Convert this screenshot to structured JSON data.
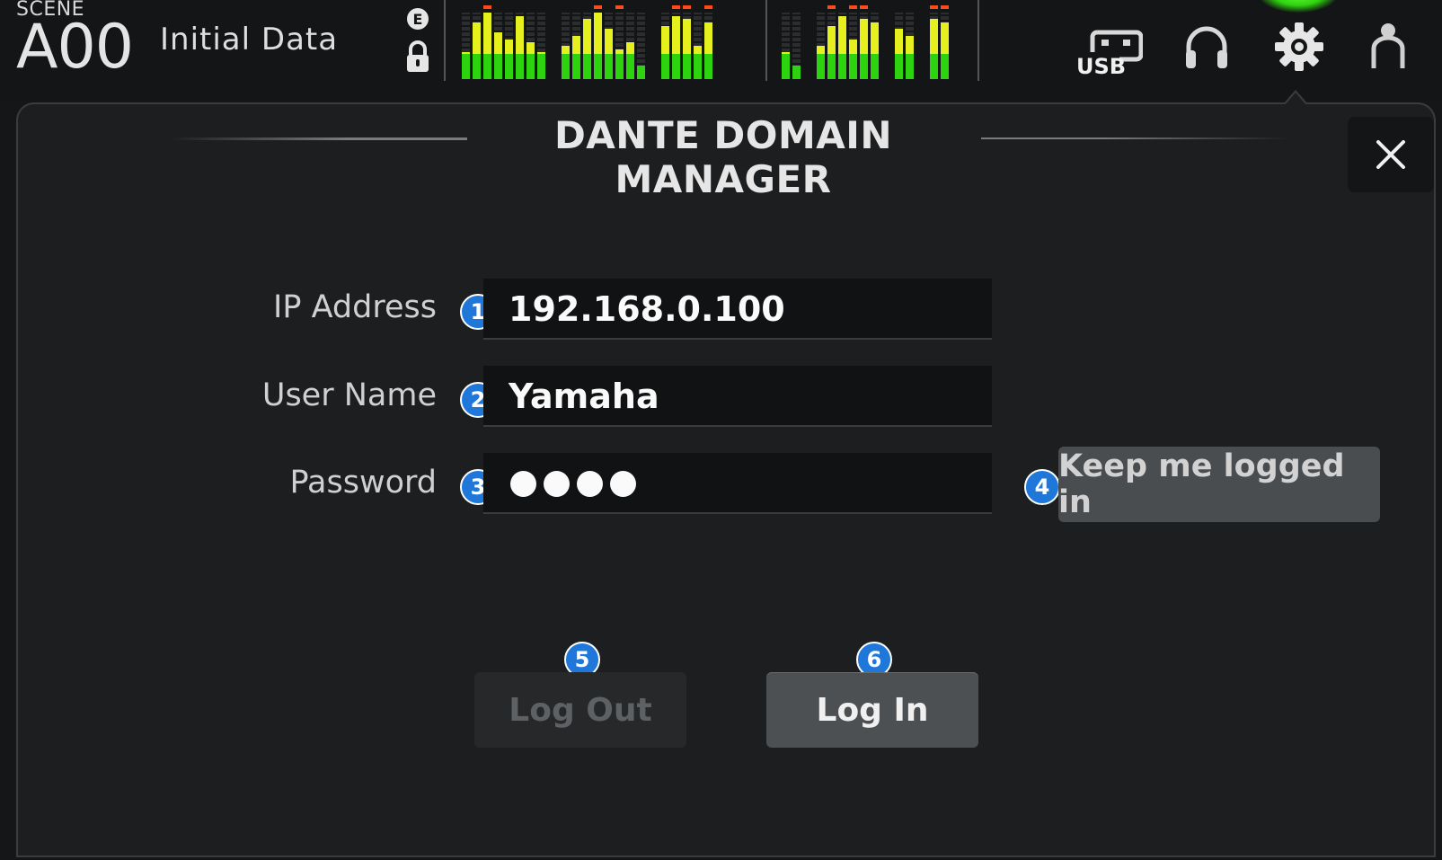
{
  "header": {
    "scene_label": "SCENE",
    "scene_number": "A00",
    "scene_title": "Initial Data",
    "edit_icon": "E",
    "usb_label": "USB",
    "icons": [
      "edit-icon",
      "lock-icon",
      "usb-icon",
      "headphones-icon",
      "gear-icon",
      "user-icon"
    ],
    "meter_colors": {
      "green": "#2ed30f",
      "yellow": "#e6f01e",
      "red": "#ff4a1c"
    }
  },
  "dialog": {
    "title": "DANTE DOMAIN MANAGER",
    "close_icon": "close-icon",
    "fields": {
      "ip_address": {
        "label": "IP Address",
        "value": "192.168.0.100",
        "badge": "1"
      },
      "user_name": {
        "label": "User Name",
        "value": "Yamaha",
        "badge": "2"
      },
      "password": {
        "label": "Password",
        "masked_length": 4,
        "badge": "3"
      }
    },
    "keep_logged_in": {
      "label": "Keep me logged in",
      "badge": "4"
    },
    "log_out": {
      "label": "Log Out",
      "badge": "5",
      "enabled": false
    },
    "log_in": {
      "label": "Log In",
      "badge": "6",
      "enabled": true
    },
    "accent_color": "#1e77d9"
  }
}
